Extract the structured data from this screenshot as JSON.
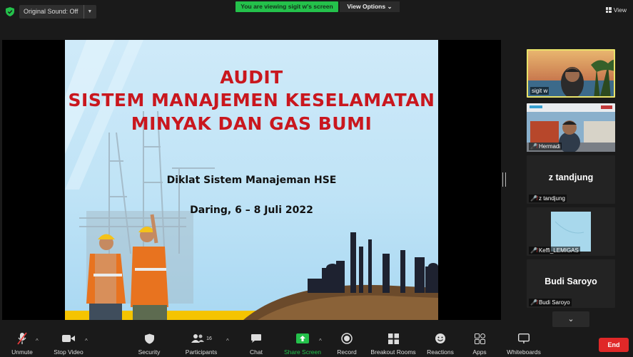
{
  "topbar": {
    "sound_label": "Original Sound: Off",
    "viewing_banner": "You are viewing sigit w's screen",
    "view_options": "View Options",
    "view_label": "View"
  },
  "slide": {
    "title_lines": [
      "AUDIT",
      "SISTEM MANAJEMEN KESELAMATAN",
      "MINYAK DAN GAS BUMI"
    ],
    "subtitle": "Diklat Sistem Manajeman HSE",
    "date": "Daring, 6 – 8 Juli 2022"
  },
  "participants": [
    {
      "name": "sigit w",
      "type": "video",
      "active": true
    },
    {
      "name": "Hermadi",
      "type": "video",
      "muted": true
    },
    {
      "name": "z tandjung",
      "type": "name",
      "display": "z tandjung",
      "muted": true
    },
    {
      "name": "Keffi_LEMIGAS",
      "type": "image",
      "muted": true
    },
    {
      "name": "Budi Saroyo",
      "type": "name",
      "display": "Budi Saroyo",
      "muted": true
    }
  ],
  "toolbar": {
    "unmute": "Unmute",
    "stop_video": "Stop Video",
    "security": "Security",
    "participants": "Participants",
    "participants_count": "16",
    "chat": "Chat",
    "share_screen": "Share Screen",
    "record": "Record",
    "breakout": "Breakout Rooms",
    "reactions": "Reactions",
    "apps": "Apps",
    "whiteboards": "Whiteboards",
    "end": "End"
  },
  "colors": {
    "accent_green": "#24c14b",
    "end_red": "#e02828",
    "title_red": "#c9171e",
    "active_border": "#e9e36a"
  }
}
